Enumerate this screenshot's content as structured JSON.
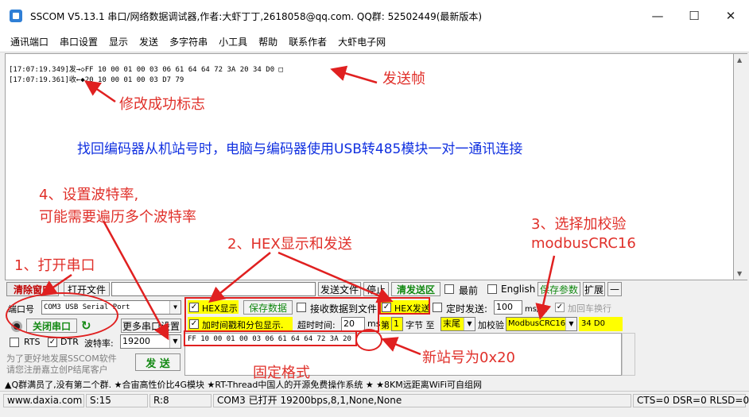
{
  "window": {
    "title": "SSCOM V5.13.1 串口/网络数据调试器,作者:大虾丁丁,2618058@qq.com. QQ群:  52502449(最新版本)",
    "minimize": "—",
    "maximize": "☐",
    "close": "✕"
  },
  "menu": [
    "通讯端口",
    "串口设置",
    "显示",
    "发送",
    "多字符串",
    "小工具",
    "帮助",
    "联系作者",
    "大虾电子网"
  ],
  "log": [
    "[17:07:19.349]发→◇FF 10 00 01 00 03 06 61 64 64 72 3A 20 34 D0 □",
    "[17:07:19.361]收←◆20 10 00 01 00 03 D7 79"
  ],
  "annotations": {
    "send_frame": "发送帧",
    "modify_success": "修改成功标志",
    "main_note": "找回编码器从机站号时，电脑与编码器使用USB转485模块一对一通讯连接",
    "step4_line1": "4、设置波特率,",
    "step4_line2": "可能需要遍历多个波特率",
    "step2": "2、HEX显示和发送",
    "step3_line1": "3、选择加校验",
    "step3_line2": "modbusCRC16",
    "step1": "1、打开串口",
    "fixed_format": "固定格式",
    "new_station": "新站号为0x20"
  },
  "toolbar": {
    "clear_window": "清除窗口",
    "open_file": "打开文件",
    "send_file": "发送文件",
    "stop": "停止",
    "clear_send": "清发送区",
    "topmost": "最前",
    "english": "English",
    "save_params": "保存参数",
    "expand": "扩展",
    "collapse": "—"
  },
  "port": {
    "port_label": "端口号",
    "port_value": "COM3 USB Serial Port",
    "close_port": "关闭串口",
    "more_settings": "更多串口设置",
    "rts": "RTS",
    "dtr": "DTR",
    "baud_label": "波特率:",
    "baud_value": "19200"
  },
  "options": {
    "hex_display": "HEX显示",
    "save_data": "保存数据",
    "recv_to_file": "接收数据到文件",
    "hex_send": "HEX发送",
    "timed_send": "定时发送:",
    "interval": "100",
    "interval_unit": "ms/次",
    "add_crlf": "加回车换行",
    "timestamp": "加时间戳和分包显示.",
    "timeout_label": "超时时间:",
    "timeout": "20",
    "timeout_unit": "ms",
    "seg_label": "第",
    "byte_from": "1",
    "byte_to_label": "字节 至",
    "byte_to": "末尾",
    "checksum_label": "加校验",
    "checksum": "ModbusCRC16",
    "checksum_value": "34 D0"
  },
  "send": {
    "content": "FF 10 00 01 00 03 06 61 64 64 72 3A 20",
    "send_button": "发  送"
  },
  "promo": {
    "line1": "为了更好地发展SSCOM软件",
    "line2": "请您注册嘉立创P结尾客户"
  },
  "ticker": "▲Q群满员了,没有第二个群. ★合宙高性价比4G模块 ★RT-Thread中国人的开源免费操作系统 ★ ★8KM远距离WiFi可自组网",
  "status": {
    "site": "www.daxia.com",
    "sent": "S:15",
    "recv": "R:8",
    "port_state": "COM3 已打开  19200bps,8,1,None,None",
    "signals": "CTS=0 DSR=0 RLSD=0"
  }
}
